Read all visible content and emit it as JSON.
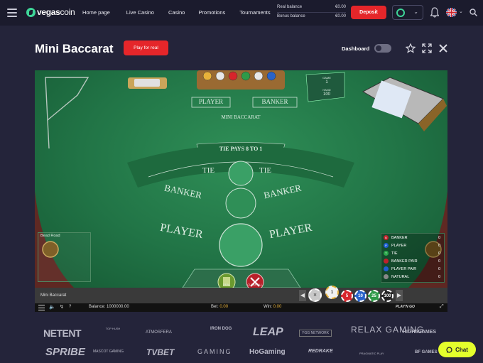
{
  "header": {
    "logo_bold": "vegas",
    "logo_light": "coin",
    "nav": [
      "Home page",
      "Live Casino",
      "Casino",
      "Promotions",
      "Tournaments"
    ],
    "real_balance_label": "Real balance",
    "real_balance_value": "€0.00",
    "bonus_balance_label": "Bonus balance",
    "bonus_balance_value": "€0.00",
    "deposit_label": "Deposit"
  },
  "page": {
    "title": "Mini Baccarat",
    "play_real_label": "Play for real",
    "dashboard_label": "Dashboard",
    "dashboard_on": false
  },
  "game": {
    "label_player_top": "PLAYER",
    "label_banker_top": "BANKER",
    "label_mini_baccarat": "MINI BACCARAT",
    "tie_pays": "TIE PAYS 8 TO 1",
    "tie": "TIE",
    "banker": "BANKER",
    "player": "PLAYER",
    "shoe_game_label": "GAME",
    "shoe_game_value": "1",
    "shoe_hand_label": "HAND",
    "shoe_hand_value": "100",
    "bead_road_title": "Bead Road",
    "legend": [
      {
        "badge": "B",
        "color": "#c0202a",
        "label": "BANKER",
        "value": "0"
      },
      {
        "badge": "P",
        "color": "#1f5fd0",
        "label": "PLAYER",
        "value": "0"
      },
      {
        "badge": "T",
        "color": "#2aa64a",
        "label": "TIE",
        "value": "0"
      },
      {
        "badge": "",
        "color": "#c0202a",
        "label": "BANKER PAIR",
        "value": "0"
      },
      {
        "badge": "",
        "color": "#1f5fd0",
        "label": "PLAYER PAIR",
        "value": "0"
      },
      {
        "badge": "",
        "color": "#888888",
        "label": "NATURAL",
        "value": "0"
      }
    ],
    "deal_label": "DEAL",
    "clear_label": "CLEAR ALL",
    "chips": [
      {
        "value": "1",
        "color": "#f1f1f1",
        "text": "#333"
      },
      {
        "value": "5",
        "color": "#d8252b",
        "text": "#fff"
      },
      {
        "value": "10",
        "color": "#2a63c9",
        "text": "#fff"
      },
      {
        "value": "25",
        "color": "#2f9a48",
        "text": "#fff"
      },
      {
        "value": "100",
        "color": "#222222",
        "text": "#fff"
      }
    ],
    "game_name": "Mini Baccarat",
    "help": "?",
    "balance_label": "Balance:",
    "balance_value": "1000000.00",
    "bet_label": "Bet:",
    "bet_value": "0.00",
    "win_label": "Win:",
    "win_value": "0.00",
    "provider_mark": "PLAY'N GO"
  },
  "providers": {
    "row1": [
      "NETENT",
      "TOP HUSH",
      "ATMOSFERA",
      "IRON DOG",
      "LEAP",
      "YGG NETWORK",
      "RELAX GAMING",
      "HIGH5GAMES"
    ],
    "row2": [
      "SPRIBE",
      "MASCOT GAMING",
      "TVBET",
      "GAMING",
      "HoGaming",
      "REDRAKE",
      "PRAGMATIC PLAY",
      "BF GAMES"
    ]
  },
  "chat_label": "Chat"
}
